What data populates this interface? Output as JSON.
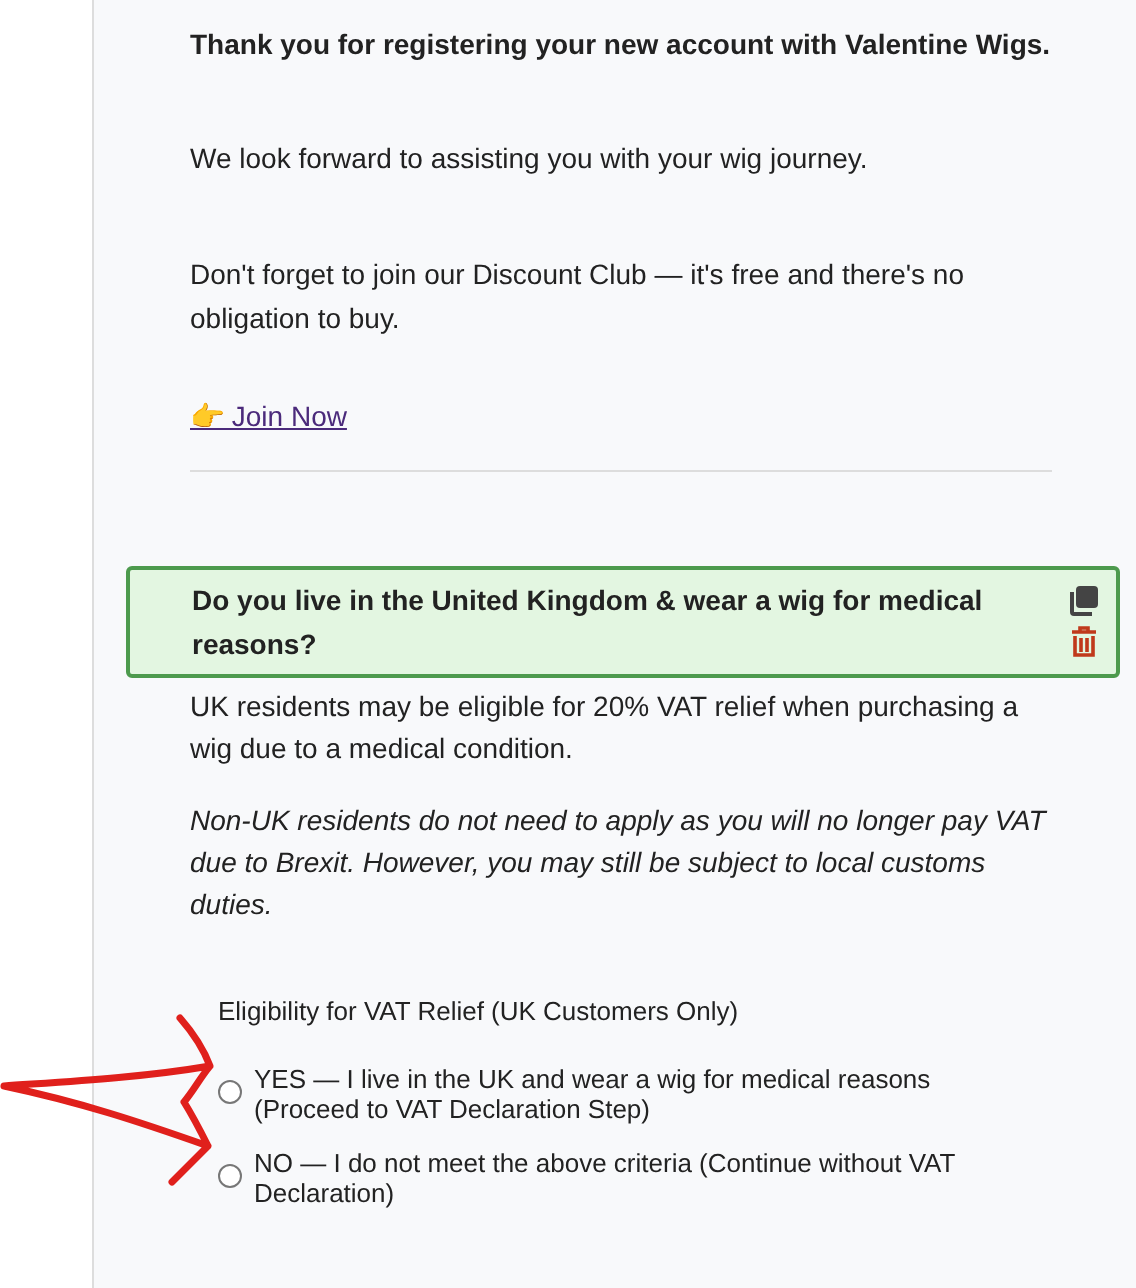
{
  "intro": {
    "heading": "Thank you for registering your new account with Valentine Wigs.",
    "paragraphs": [
      "We look forward to assisting you with your wig journey.",
      "Don't forget to join our Discount Club — it's free and there's no obligation to buy."
    ],
    "link": "👉 Join Now"
  },
  "question": {
    "title": "Do you live in the United Kingdom & wear a wig for medical reasons?"
  },
  "notes": [
    {
      "kind": "plain",
      "text": "UK residents may be eligible for 20% VAT relief when purchasing a wig due to a medical condition."
    },
    {
      "kind": "italic",
      "text": "Non-UK residents do not need to apply as you will no longer pay VAT due to Brexit. However, you may still be subject to local customs duties."
    }
  ],
  "eligibility": {
    "legend": "Eligibility for VAT Relief (UK Customers Only)",
    "options": [
      {
        "label": "YES — I live in the UK and wear a wig for medical reasons (Proceed to VAT Declaration Step)",
        "selected": false
      },
      {
        "label": "NO — I do not meet the above criteria (Continue without VAT Declaration)",
        "selected": false
      }
    ]
  }
}
